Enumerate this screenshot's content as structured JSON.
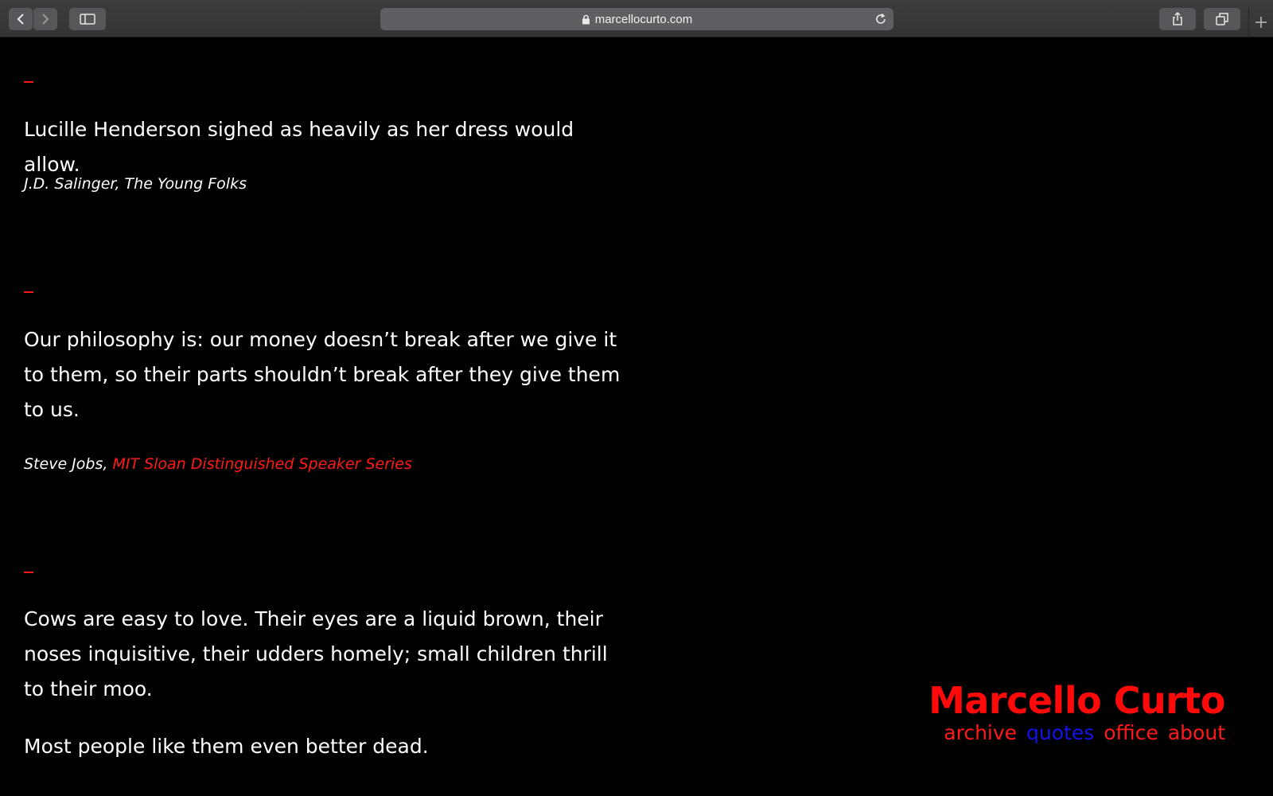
{
  "browser": {
    "url": "marcellocurto.com",
    "icons": {
      "back": "chevron-left-icon",
      "forward": "chevron-right-icon",
      "sidebar": "sidebar-icon",
      "lock": "lock-icon",
      "reload": "reload-icon",
      "share": "share-icon",
      "tabs": "tabs-icon",
      "new_tab": "plus-icon"
    }
  },
  "quotes": [
    {
      "text": "Lucille Henderson sighed as heavily as her dress would allow.",
      "citation": "J.D. Salinger, The Young Folks"
    },
    {
      "text": "Our philosophy is: our money doesn’t break after we give it to them, so their parts shouldn’t break after they give them to us.",
      "author": "Steve Jobs,",
      "source_link": "MIT Sloan Distinguished Speaker Series"
    },
    {
      "paragraphs": [
        "Cows are easy to love. Their eyes are a liquid brown, their noses inquisitive, their udders homely; small children thrill to their moo.",
        "Most people like them even better dead."
      ]
    }
  ],
  "site": {
    "title": "Marcello Curto",
    "nav": [
      {
        "label": "archive",
        "color": "#ff1a1a"
      },
      {
        "label": "quotes",
        "color": "#1414e6",
        "active": true
      },
      {
        "label": "office",
        "color": "#ff1a1a"
      },
      {
        "label": "about",
        "color": "#ff1a1a"
      }
    ]
  },
  "colors": {
    "background": "#000000",
    "text": "#ffffff",
    "accent_red": "#ff1a1a",
    "active_blue": "#1414e6"
  }
}
